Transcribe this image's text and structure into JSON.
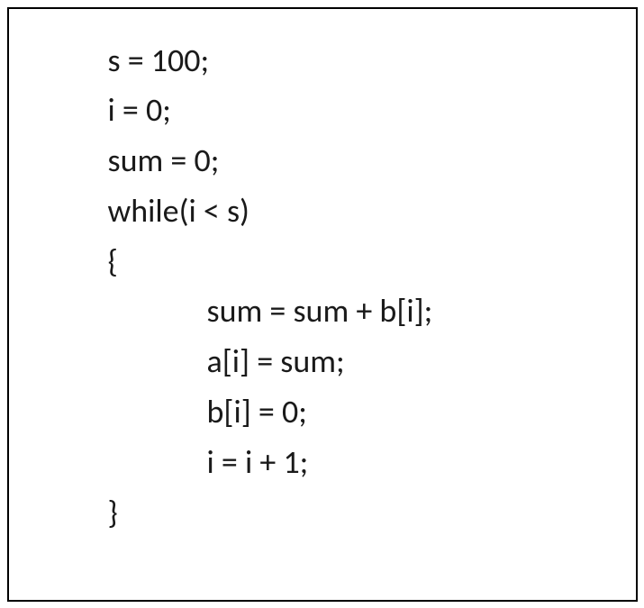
{
  "code": {
    "line1": "s = 100;",
    "line2": "i = 0;",
    "line3": "sum = 0;",
    "line4": "while(i < s)",
    "line5": "{",
    "line6": "sum = sum + b[i];",
    "line7": "a[i] = sum;",
    "line8": "b[i] = 0;",
    "line9": "i = i + 1;",
    "line10": "}"
  }
}
